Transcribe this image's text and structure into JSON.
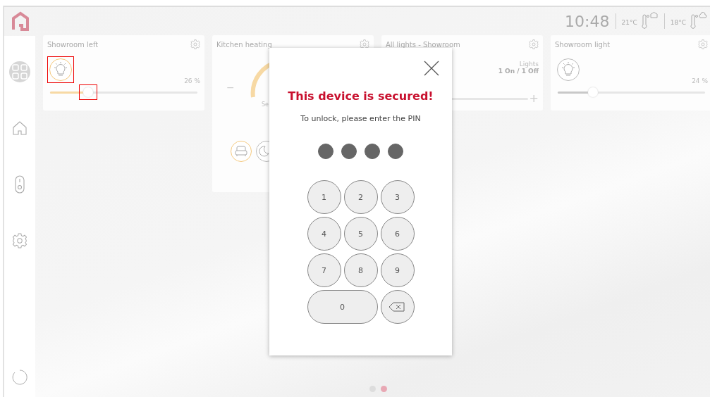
{
  "header": {
    "time": "10:48",
    "temperatures": [
      {
        "value": "21°C",
        "kind": "indoor"
      },
      {
        "value": "18°C",
        "kind": "outdoor"
      }
    ]
  },
  "sidebar": {
    "items": [
      {
        "kind": "dashboard",
        "selected": true
      },
      {
        "kind": "home",
        "selected": false
      },
      {
        "kind": "remote",
        "selected": false
      },
      {
        "kind": "settings",
        "selected": false
      }
    ]
  },
  "cards": [
    {
      "kind": "dimmer",
      "title": "Showroom left",
      "value": "26 %",
      "level": 0.26,
      "on": true,
      "highlighted": true
    },
    {
      "kind": "heating",
      "title": "Kitchen heating",
      "minus": "−",
      "caption": "Se",
      "modes": [
        {
          "kind": "comfort",
          "selected": true
        },
        {
          "kind": "night",
          "selected": false
        }
      ]
    },
    {
      "kind": "group",
      "title": "All lights - Showroom",
      "label": "Lights",
      "status": "1 On / 1 Off",
      "plus": "+"
    },
    {
      "kind": "dimmer",
      "title": "Showroom light",
      "value": "24 %",
      "level": 0.24,
      "on": false,
      "highlighted": false
    }
  ],
  "dialog": {
    "title": "This device is secured!",
    "message": "To unlock, please enter the PIN",
    "pin_dots": [
      {
        "filled": true
      },
      {
        "filled": true
      },
      {
        "filled": true
      },
      {
        "filled": true
      }
    ],
    "keys": [
      {
        "kind": "digit",
        "label": "1"
      },
      {
        "kind": "digit",
        "label": "2"
      },
      {
        "kind": "digit",
        "label": "3"
      },
      {
        "kind": "digit",
        "label": "4"
      },
      {
        "kind": "digit",
        "label": "5"
      },
      {
        "kind": "digit",
        "label": "6"
      },
      {
        "kind": "digit",
        "label": "7"
      },
      {
        "kind": "digit",
        "label": "8"
      },
      {
        "kind": "digit",
        "label": "9"
      },
      {
        "kind": "wide",
        "label": "0"
      },
      {
        "kind": "backspace"
      }
    ]
  },
  "pages": [
    {
      "selected": false
    },
    {
      "selected": true
    }
  ]
}
